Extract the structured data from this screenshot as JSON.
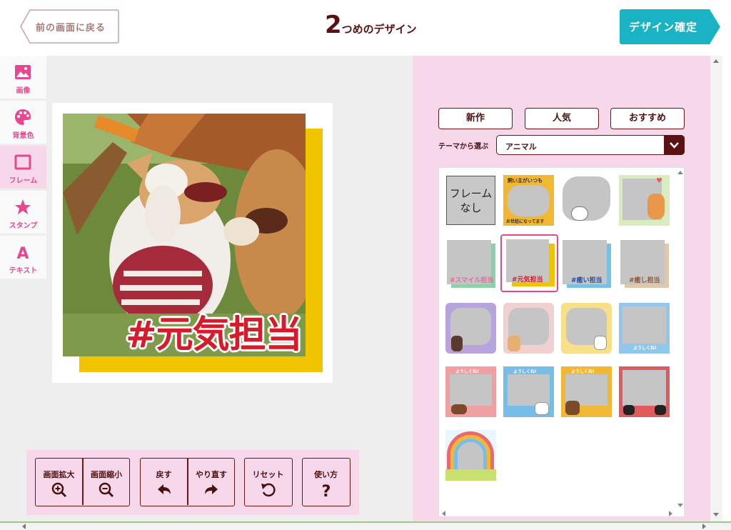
{
  "header": {
    "back_label": "前の画面に戻る",
    "title_number": "2",
    "title_text": "つめのデザイン",
    "confirm_label": "デザイン確定"
  },
  "tools": [
    {
      "label": "画像",
      "icon": "image-icon"
    },
    {
      "label": "背景色",
      "icon": "palette-icon"
    },
    {
      "label": "フレーム",
      "icon": "frame-icon",
      "active": true
    },
    {
      "label": "スタンプ",
      "icon": "star-icon"
    },
    {
      "label": "テキスト",
      "icon": "text-icon"
    }
  ],
  "canvas": {
    "stamp_text": "#元気担当",
    "frame_color": "#f0c500"
  },
  "panel": {
    "sort_buttons": [
      "新作",
      "人気",
      "おすすめ"
    ],
    "theme_label": "テーマから選ぶ",
    "theme_value": "アニマル"
  },
  "frames": {
    "no_frame_label": "フレーム\nなし",
    "hashtags": [
      "#スマイル担当",
      "#元気担当",
      "#癒い担当",
      "#癒し担当"
    ],
    "text_1": "飼い主がいつも",
    "text_2": "お世話になってます",
    "yoroshiku": "ようしくね!",
    "selected": "#元気担当"
  },
  "toolbar": {
    "zoom_in": "画面拡大",
    "zoom_out": "画面縮小",
    "undo": "戻す",
    "redo": "やり直す",
    "reset": "リセット",
    "help": "使い方"
  },
  "colors": {
    "accent_pink": "#e8478f",
    "panel_pink": "#f7d8ea",
    "confirm_teal": "#1ab3c4",
    "dark_maroon": "#5c1212"
  }
}
